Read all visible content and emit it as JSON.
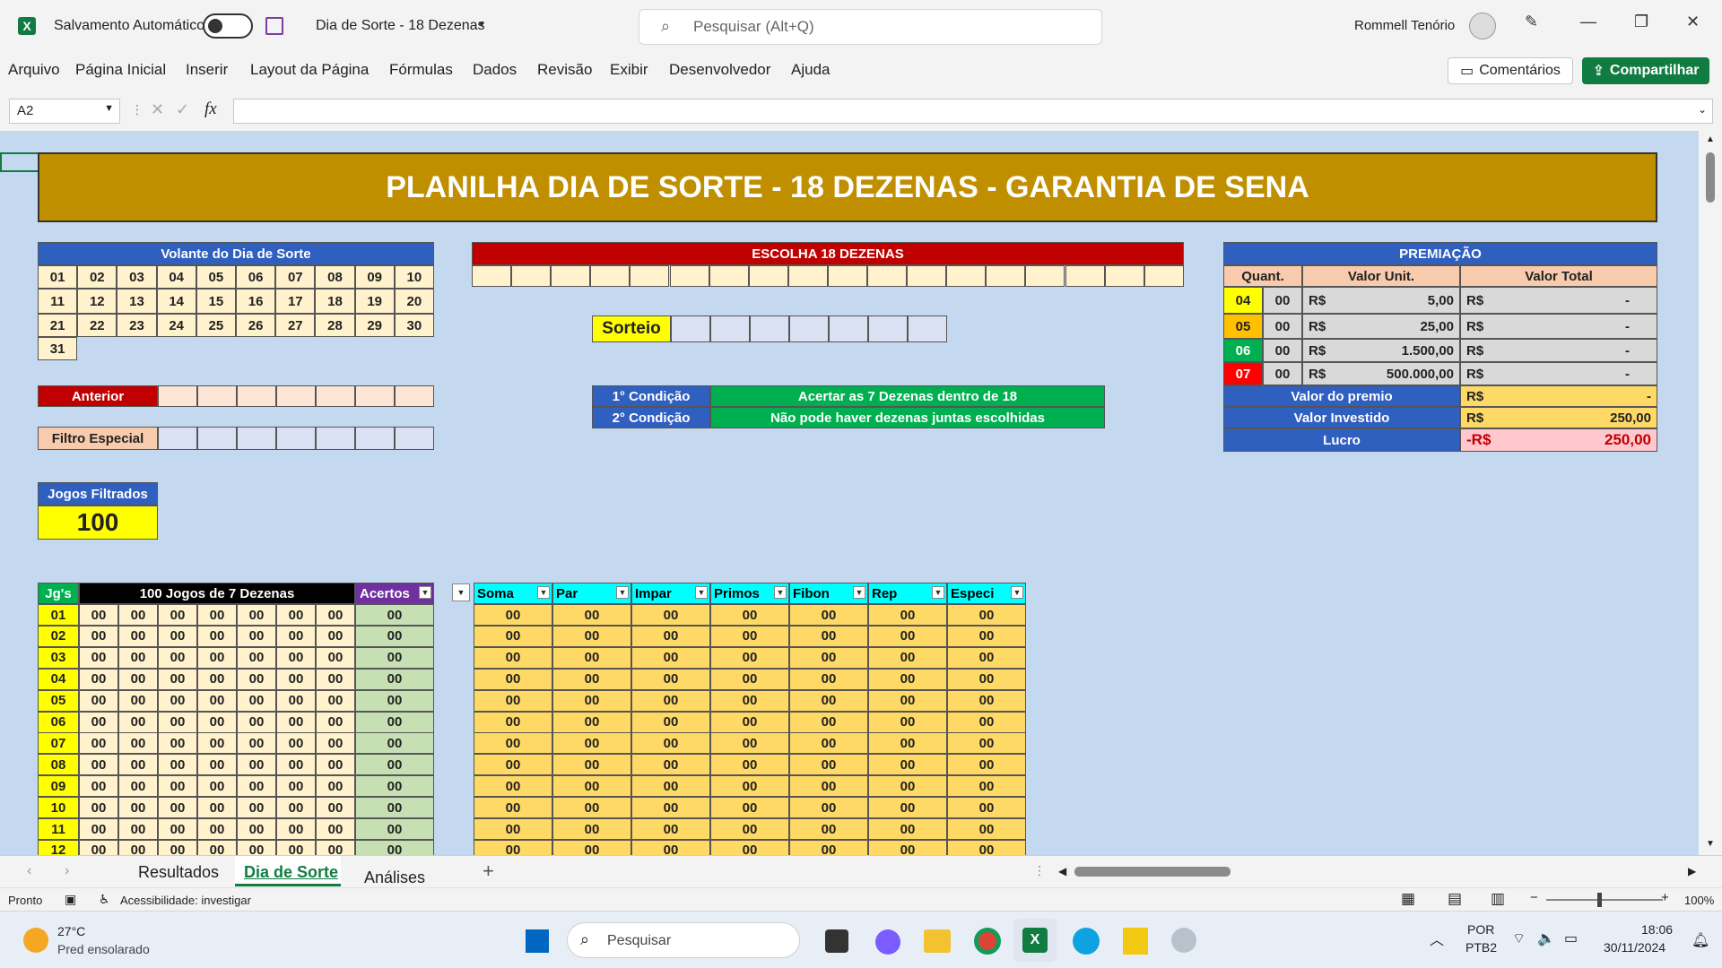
{
  "titlebar": {
    "autosave_label": "Salvamento Automático",
    "doc_title": "Dia de Sorte - 18 Dezenas",
    "search_placeholder": "Pesquisar (Alt+Q)",
    "user_name": "Rommell Tenório"
  },
  "menu": [
    "Arquivo",
    "Página Inicial",
    "Inserir",
    "Layout da Página",
    "Fórmulas",
    "Dados",
    "Revisão",
    "Exibir",
    "Desenvolvedor",
    "Ajuda"
  ],
  "actions": {
    "comments": "Comentários",
    "share": "Compartilhar"
  },
  "formula": {
    "namebox": "A2",
    "fx": "fx",
    "content": ""
  },
  "sheet": {
    "title": "PLANILHA DIA DE SORTE - 18 DEZENAS - GARANTIA DE SENA",
    "volante_title": "Volante do Dia de Sorte",
    "volante": [
      [
        "01",
        "02",
        "03",
        "04",
        "05",
        "06",
        "07",
        "08",
        "09",
        "10"
      ],
      [
        "11",
        "12",
        "13",
        "14",
        "15",
        "16",
        "17",
        "18",
        "19",
        "20"
      ],
      [
        "21",
        "22",
        "23",
        "24",
        "25",
        "26",
        "27",
        "28",
        "29",
        "30"
      ],
      [
        "31"
      ]
    ],
    "escolha_title": "ESCOLHA 18 DEZENAS",
    "sorteio_label": "Sorteio",
    "anterior_label": "Anterior",
    "filtro_label": "Filtro Especial",
    "jogos_filtrados_label": "Jogos Filtrados",
    "jogos_filtrados_value": "100",
    "cond1_label": "1° Condição",
    "cond1_text": "Acertar as 7 Dezenas dentro de 18",
    "cond2_label": "2° Condição",
    "cond2_text": "Não pode haver dezenas juntas escolhidas",
    "premiacao": {
      "title": "PREMIAÇÃO",
      "headers": [
        "Quant.",
        "Valor Unit.",
        "Valor Total"
      ],
      "rows": [
        {
          "hits": "04",
          "qty": "00",
          "cur": "R$",
          "unit": "5,00",
          "tcur": "R$",
          "total": "-"
        },
        {
          "hits": "05",
          "qty": "00",
          "cur": "R$",
          "unit": "25,00",
          "tcur": "R$",
          "total": "-"
        },
        {
          "hits": "06",
          "qty": "00",
          "cur": "R$",
          "unit": "1.500,00",
          "tcur": "R$",
          "total": "-"
        },
        {
          "hits": "07",
          "qty": "00",
          "cur": "R$",
          "unit": "500.000,00",
          "tcur": "R$",
          "total": "-"
        }
      ],
      "valor_premio_label": "Valor do premio",
      "valor_premio_cur": "R$",
      "valor_premio": "-",
      "valor_investido_label": "Valor Investido",
      "valor_investido_cur": "R$",
      "valor_investido": "250,00",
      "lucro_label": "Lucro",
      "lucro_cur": "-R$",
      "lucro": "250,00"
    },
    "jogos": {
      "col_jg": "Jg's",
      "col_title": "100 Jogos de 7 Dezenas",
      "col_acertos": "Acertos",
      "stat_headers": [
        "Soma",
        "Par",
        "Impar",
        "Primos",
        "Fibon",
        "Rep",
        "Especi"
      ],
      "rows": [
        "01",
        "02",
        "03",
        "04",
        "05",
        "06",
        "07",
        "08",
        "09",
        "10",
        "11",
        "12"
      ],
      "zero": "00"
    }
  },
  "tabs": [
    "Resultados",
    "Dia de Sorte",
    "Análises"
  ],
  "status": {
    "ready": "Pronto",
    "accessibility": "Acessibilidade: investigar",
    "zoom": "100%"
  },
  "taskbar": {
    "temp": "27°C",
    "weather": "Pred ensolarado",
    "search": "Pesquisar",
    "lang1": "POR",
    "lang2": "PTB2",
    "time": "18:06",
    "date": "30/11/2024"
  }
}
